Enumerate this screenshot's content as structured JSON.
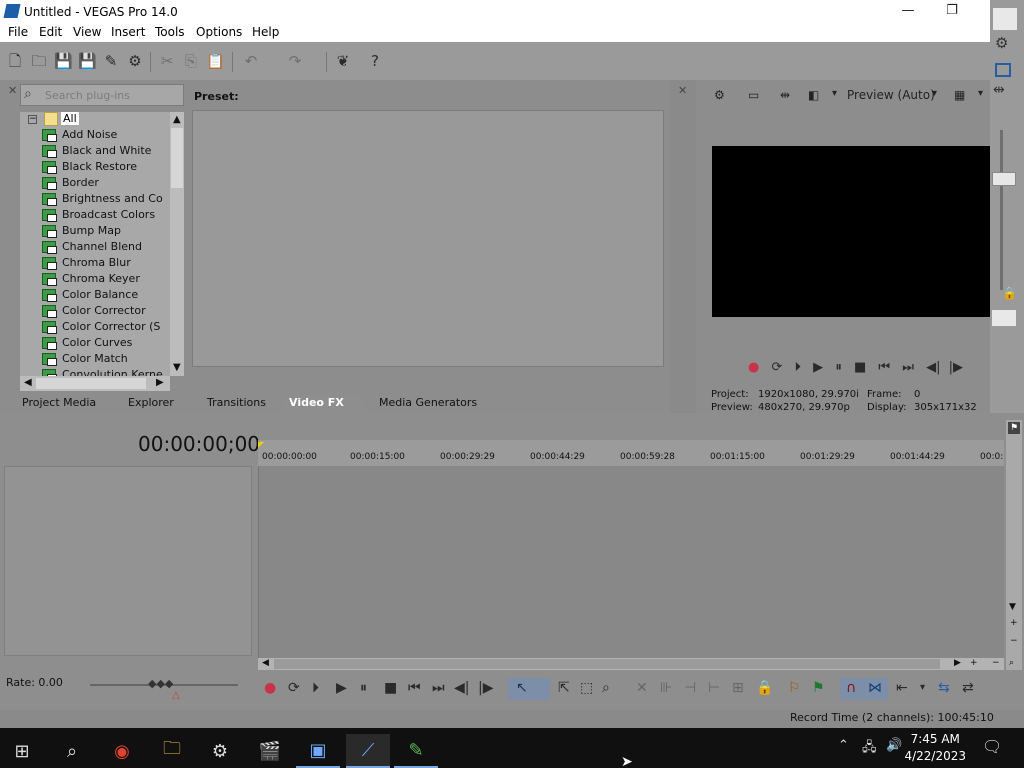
{
  "window": {
    "title": "Untitled - VEGAS Pro 14.0",
    "minimize": "—",
    "restore": "❐"
  },
  "menu": [
    "File",
    "Edit",
    "View",
    "Insert",
    "Tools",
    "Options",
    "Help"
  ],
  "plugin_chooser": {
    "search_placeholder": "Search plug-ins",
    "preset_label": "Preset:",
    "root": "All",
    "items": [
      "Add Noise",
      "Black and White",
      "Black Restore",
      "Border",
      "Brightness and Co",
      "Broadcast Colors",
      "Bump Map",
      "Channel Blend",
      "Chroma Blur",
      "Chroma Keyer",
      "Color Balance",
      "Color Corrector",
      "Color Corrector (S",
      "Color Curves",
      "Color Match",
      "Convolution Kerne"
    ]
  },
  "tabs": [
    "Project Media",
    "Explorer",
    "Transitions",
    "Video FX",
    "Media Generators"
  ],
  "active_tab": "Video FX",
  "preview": {
    "mode": "Preview (Auto)",
    "project_label": "Project:",
    "project_value": "1920x1080, 29.970i",
    "preview_label": "Preview:",
    "preview_value": "480x270, 29.970p",
    "frame_label": "Frame:",
    "frame_value": "0",
    "display_label": "Display:",
    "display_value": "305x171x32"
  },
  "timeline": {
    "timecode": "00:00:00;00",
    "ruler": [
      "00:00:00:00",
      "00:00:15:00",
      "00:00:29:29",
      "00:00:44:29",
      "00:00:59:28",
      "00:01:15:00",
      "00:01:29:29",
      "00:01:44:29",
      "00:0:"
    ],
    "rate": "Rate: 0.00",
    "record_time": "Record Time (2 channels): 100:45:10"
  },
  "taskbar": {
    "time": "7:45 AM",
    "date": "4/22/2023"
  },
  "colors": {
    "preview_bg": "#000000",
    "record": "#c8324a",
    "accent": "#1c5fa8"
  }
}
